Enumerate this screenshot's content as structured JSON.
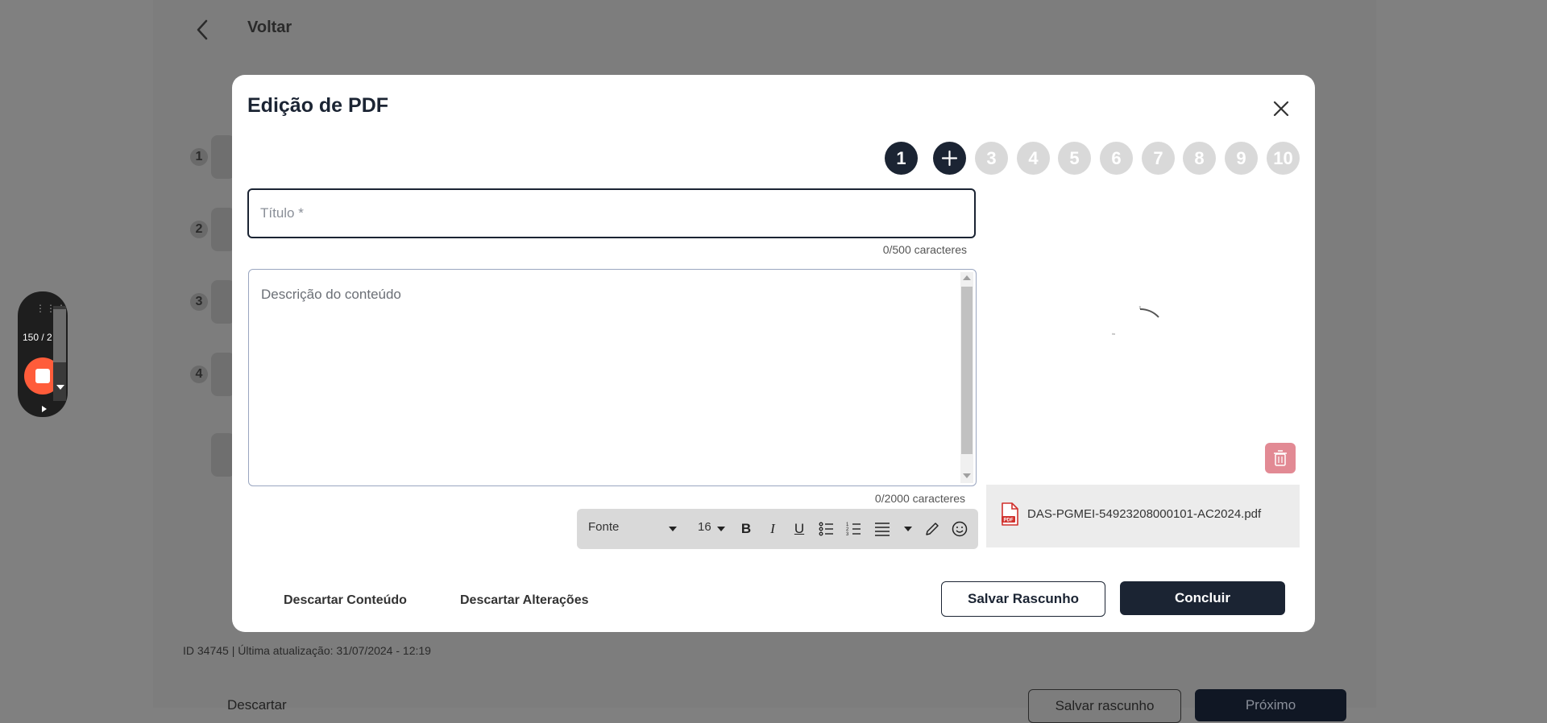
{
  "background_page": {
    "back_label": "Voltar",
    "steps": [
      {
        "number": "1"
      },
      {
        "number": "2"
      },
      {
        "number": "3"
      },
      {
        "number": "4"
      }
    ],
    "meta": "ID 34745 | Última atualização: 31/07/2024 - 12:19",
    "footer": {
      "discard_label": "Descartar",
      "save_draft_label": "Salvar rascunho",
      "next_label": "Próximo"
    }
  },
  "recorder": {
    "counter": "150 / 2"
  },
  "modal": {
    "title": "Edição de PDF",
    "pages": [
      {
        "label": "1",
        "active": true
      },
      {
        "label": "+",
        "active": true
      },
      {
        "label": "3",
        "active": false
      },
      {
        "label": "4",
        "active": false
      },
      {
        "label": "5",
        "active": false
      },
      {
        "label": "6",
        "active": false
      },
      {
        "label": "7",
        "active": false
      },
      {
        "label": "8",
        "active": false
      },
      {
        "label": "9",
        "active": false
      },
      {
        "label": "10",
        "active": false
      }
    ],
    "title_field": {
      "placeholder": "Título *",
      "value": "",
      "counter": "0/500 caracteres"
    },
    "description_field": {
      "placeholder": "Descrição do conteúdo",
      "counter": "0/2000 caracteres"
    },
    "toolbar": {
      "font_label": "Fonte",
      "size_label": "16",
      "bold": "B",
      "italic": "I",
      "underline": "U"
    },
    "file": {
      "name": "DAS-PGMEI-54923208000101-AC2024.pdf",
      "icon_badge": "PDF"
    },
    "actions": {
      "discard_content": "Descartar Conteúdo",
      "discard_changes": "Descartar Alterações",
      "save_draft": "Salvar Rascunho",
      "conclude": "Concluir"
    },
    "colors": {
      "primary": "#1b2433",
      "inactive_page": "#d9d9d9",
      "danger": "#e28a94",
      "pdf_red": "#d0312d"
    }
  }
}
